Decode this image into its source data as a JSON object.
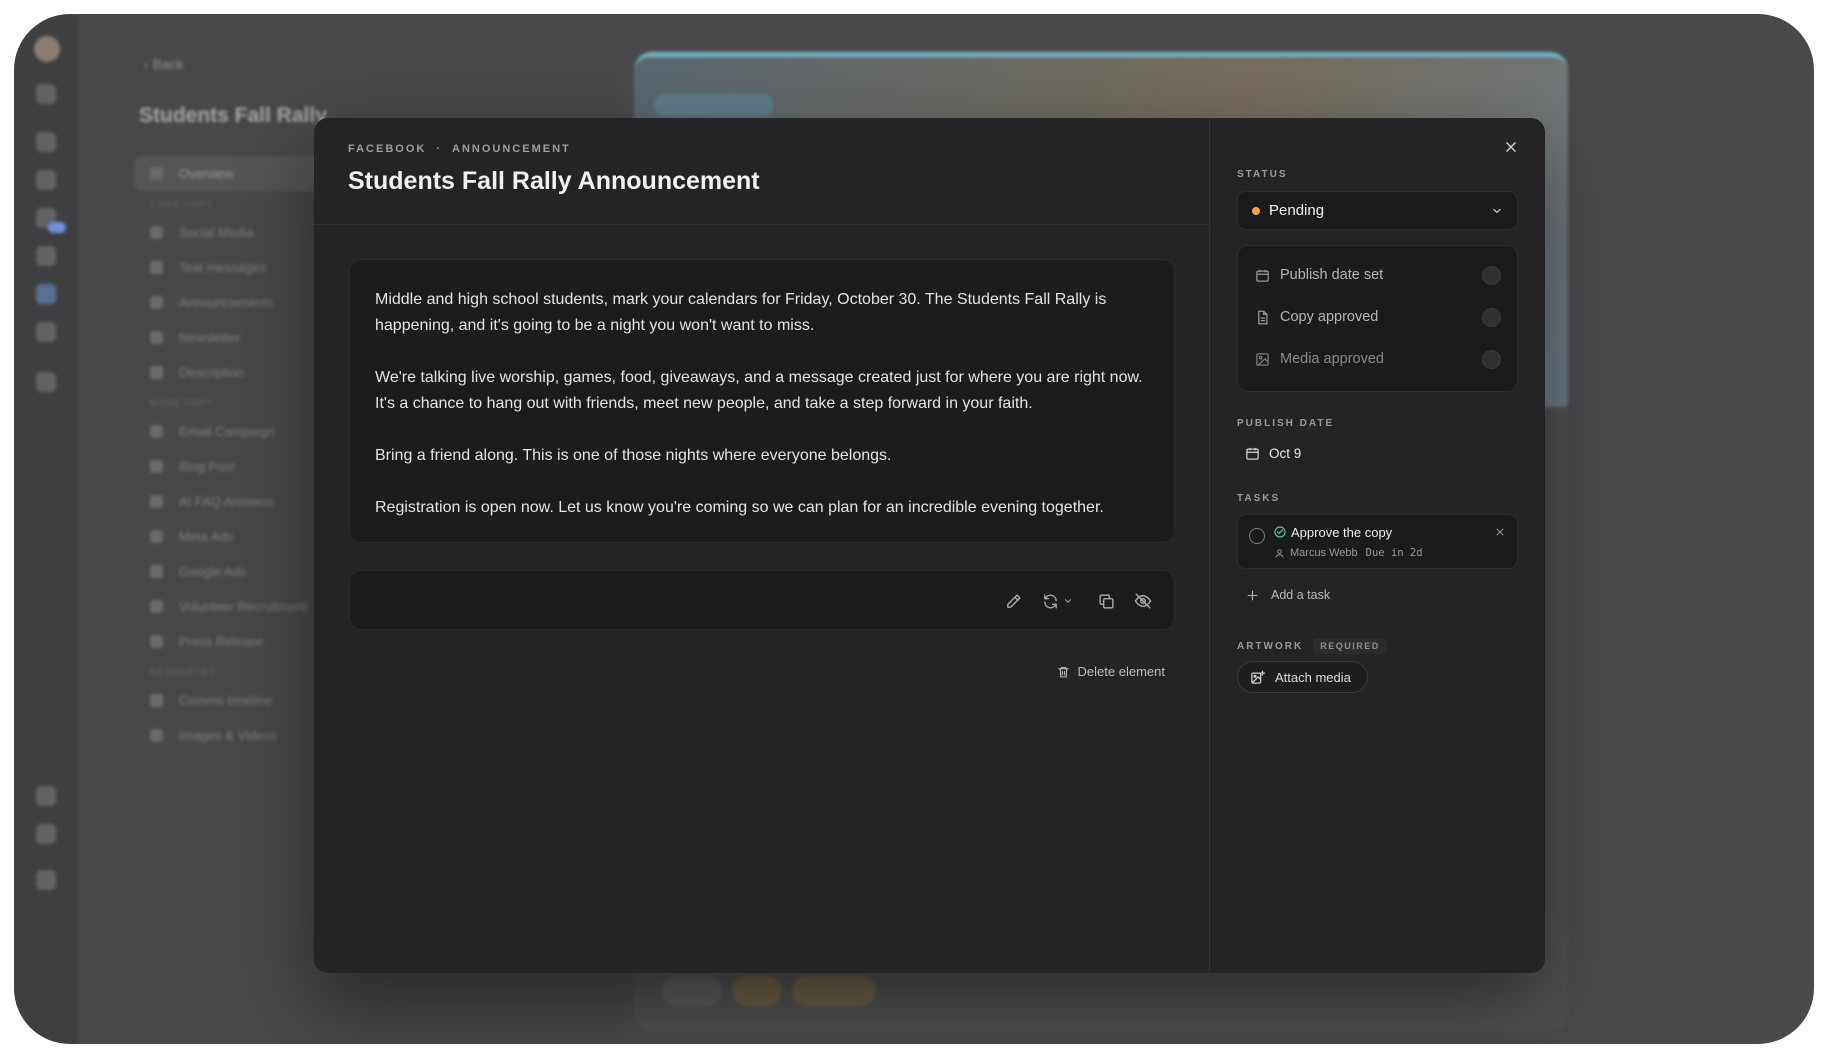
{
  "background": {
    "back_label": "Back",
    "project_title": "Students Fall Rally",
    "nav": {
      "overview": "Overview",
      "section_core": "CORE COPY",
      "items_core": [
        "Social Media",
        "Text messages",
        "Announcements",
        "Newsletter",
        "Description"
      ],
      "section_more": "MORE COPY",
      "items_more": [
        "Email Campaign",
        "Blog Post",
        "AI FAQ Answers",
        "Meta Ads",
        "Google Ads",
        "Volunteer Recruitment",
        "Press Release"
      ],
      "section_resources": "RESOURCES",
      "items_resources": [
        "Comms timeline",
        "Images & Videos"
      ]
    }
  },
  "modal": {
    "eyebrow_platform": "FACEBOOK",
    "eyebrow_separator": "·",
    "eyebrow_type": "ANNOUNCEMENT",
    "title": "Students Fall Rally Announcement",
    "copy_paragraphs": [
      "Middle and high school students, mark your calendars for Friday, October 30. The Students Fall Rally is happening, and it's going to be a night you won't want to miss.",
      "We're talking live worship, games, food, giveaways, and a message created just for where you are right now. It's a chance to hang out with friends, meet new people, and take a step forward in your faith.",
      "Bring a friend along. This is one of those nights where everyone belongs.",
      "Registration is open now. Let us know you're coming so we can plan for an incredible evening together."
    ],
    "toolbar_icons": [
      "pencil-icon",
      "refresh-icon",
      "chevron-down-icon",
      "copy-icon",
      "eye-off-icon"
    ],
    "delete_label": "Delete element"
  },
  "sidebar": {
    "status_label": "STATUS",
    "status_value": "Pending",
    "status_color": "#f0a43a",
    "checklist": [
      {
        "label": "Publish date set",
        "icon": "calendar-icon",
        "checked": false
      },
      {
        "label": "Copy approved",
        "icon": "document-icon",
        "checked": false
      },
      {
        "label": "Media approved",
        "icon": "image-icon",
        "checked": false
      }
    ],
    "publish_date_label": "PUBLISH DATE",
    "publish_date": "Oct 9",
    "tasks_label": "TASKS",
    "task": {
      "name": "Approve the copy",
      "assignee": "Marcus Webb",
      "due": "Due in 2d"
    },
    "add_task_label": "Add a task",
    "artwork_label": "ARTWORK",
    "artwork_required": "REQUIRED",
    "attach_label": "Attach media"
  }
}
